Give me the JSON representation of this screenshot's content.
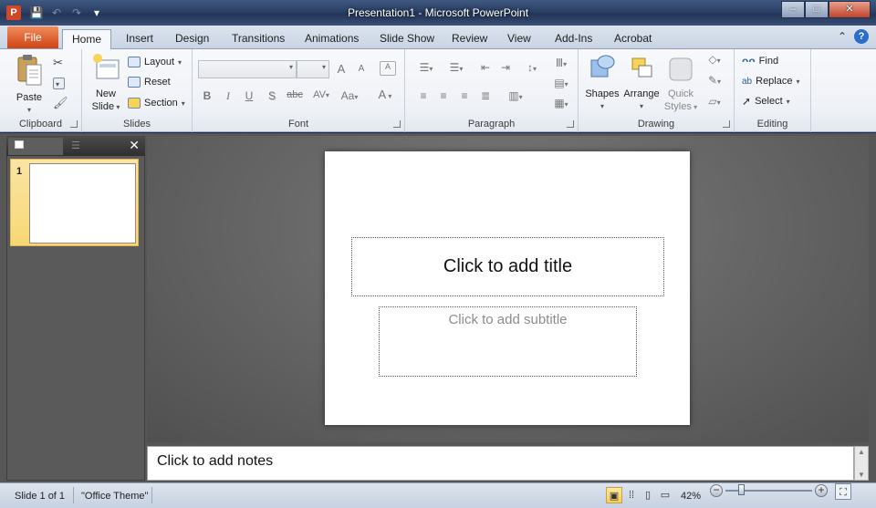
{
  "window": {
    "title": "Presentation1 - Microsoft PowerPoint",
    "app_icon_letter": "P",
    "minimize": "‒",
    "maximize": "□",
    "close": "✕"
  },
  "qat": {
    "save": "💾",
    "undo": "↶",
    "redo": "↷",
    "customize": "▾"
  },
  "tabs": [
    {
      "label": "File"
    },
    {
      "label": "Home"
    },
    {
      "label": "Insert"
    },
    {
      "label": "Design"
    },
    {
      "label": "Transitions"
    },
    {
      "label": "Animations"
    },
    {
      "label": "Slide Show"
    },
    {
      "label": "Review"
    },
    {
      "label": "View"
    },
    {
      "label": "Add-Ins"
    },
    {
      "label": "Acrobat"
    }
  ],
  "tab_right": {
    "collapse": "⌃",
    "help": "?"
  },
  "ribbon": {
    "clipboard": {
      "label": "Clipboard",
      "paste": "Paste"
    },
    "slides": {
      "label": "Slides",
      "new_slide_1": "New",
      "new_slide_2": "Slide",
      "layout": "Layout",
      "reset": "Reset",
      "section": "Section"
    },
    "font": {
      "label": "Font",
      "bold": "B",
      "italic": "I",
      "underline": "U",
      "shadow": "S",
      "strike": "abc",
      "spacing": "AV",
      "case": "Aa",
      "grow": "A",
      "shrink": "A",
      "color": "A"
    },
    "paragraph": {
      "label": "Paragraph"
    },
    "drawing": {
      "label": "Drawing",
      "shapes": "Shapes",
      "arrange": "Arrange",
      "quick_styles_1": "Quick",
      "quick_styles_2": "Styles"
    },
    "editing": {
      "label": "Editing",
      "find": "Find",
      "replace": "Replace",
      "select": "Select"
    }
  },
  "slides_pane": {
    "thumbnail_number": "1",
    "close": "✕"
  },
  "slide": {
    "title_placeholder": "Click to add title",
    "subtitle_placeholder": "Click to add subtitle"
  },
  "notes": {
    "placeholder": "Click to add notes"
  },
  "status": {
    "slide_info": "Slide 1 of 1",
    "theme": "\"Office Theme\"",
    "zoom": "42%",
    "zoom_level_percent": 42
  }
}
